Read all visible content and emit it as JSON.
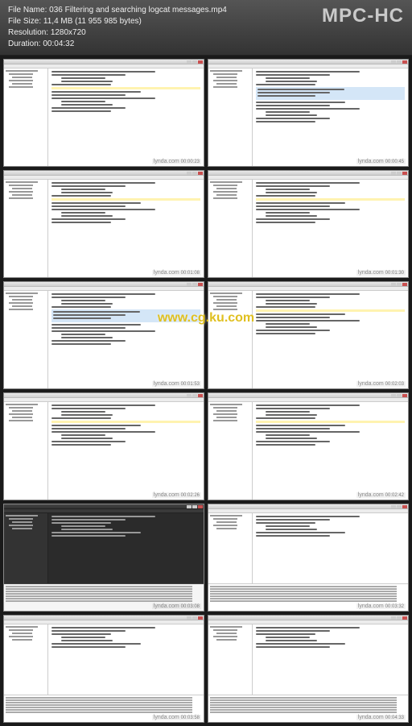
{
  "header": {
    "file_name_label": "File Name:",
    "file_name": "036 Filtering and searching logcat messages.mp4",
    "file_size_label": "File Size:",
    "file_size": "11,4 MB (11 955 985 bytes)",
    "resolution_label": "Resolution:",
    "resolution": "1280x720",
    "duration_label": "Duration:",
    "duration": "00:04:32",
    "app_name": "MPC-HC"
  },
  "center_watermark": "www.cg.ku.com",
  "thumbnails": [
    {
      "watermark": "lynda.com",
      "timestamp": "00:00:23",
      "dark": false,
      "has_highlight": false,
      "has_bottom": false
    },
    {
      "watermark": "lynda.com",
      "timestamp": "00:00:45",
      "dark": false,
      "has_highlight": true,
      "has_bottom": false
    },
    {
      "watermark": "lynda.com",
      "timestamp": "00:01:08",
      "dark": false,
      "has_highlight": false,
      "has_bottom": false
    },
    {
      "watermark": "lynda.com",
      "timestamp": "00:01:30",
      "dark": false,
      "has_highlight": false,
      "has_bottom": false
    },
    {
      "watermark": "lynda.com",
      "timestamp": "00:01:53",
      "dark": false,
      "has_highlight": true,
      "has_bottom": false
    },
    {
      "watermark": "lynda.com",
      "timestamp": "00:02:03",
      "dark": false,
      "has_highlight": false,
      "has_bottom": false
    },
    {
      "watermark": "lynda.com",
      "timestamp": "00:02:26",
      "dark": false,
      "has_highlight": false,
      "has_bottom": false
    },
    {
      "watermark": "lynda.com",
      "timestamp": "00:02:42",
      "dark": false,
      "has_highlight": false,
      "has_bottom": false
    },
    {
      "watermark": "lynda.com",
      "timestamp": "00:03:08",
      "dark": true,
      "has_highlight": false,
      "has_bottom": true
    },
    {
      "watermark": "lynda.com",
      "timestamp": "00:03:32",
      "dark": false,
      "has_highlight": false,
      "has_bottom": true
    },
    {
      "watermark": "lynda.com",
      "timestamp": "00:03:58",
      "dark": false,
      "has_highlight": false,
      "has_bottom": true
    },
    {
      "watermark": "lynda.com",
      "timestamp": "00:04:33",
      "dark": false,
      "has_highlight": false,
      "has_bottom": true
    }
  ]
}
